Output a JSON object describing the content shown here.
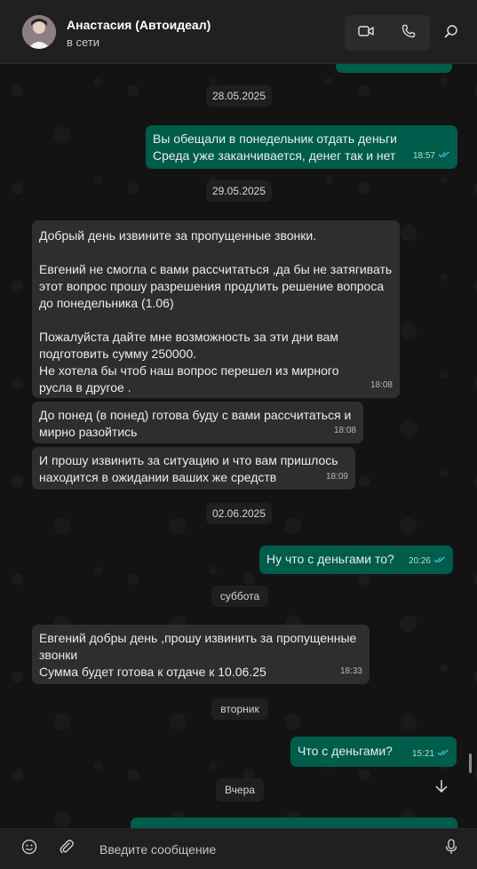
{
  "header": {
    "contact_name": "Анастасия (Автоидеал)",
    "contact_status": "в сети"
  },
  "dates": [
    "28.05.2025",
    "29.05.2025",
    "02.06.2025",
    "суббота",
    "вторник",
    "Вчера"
  ],
  "messages": [
    {
      "dir": "out",
      "text": "Вы обещали в понедельник отдать деньги\nСреда уже заканчивается, денег так и нет",
      "time": "18:57"
    },
    {
      "dir": "in",
      "text": "Добрый день извините за пропущенные звонки.\n\nЕвгений не смогла с вами рассчитаться ,да бы не затягивать\nэтот вопрос прошу разрешения продлить решение вопроса\nдо понедельника (1.06)\n\nПожалуйста дайте мне возможность за эти дни вам\nподготовить сумму 250000.\nНе хотела бы чтоб наш вопрос перешел из мирного\nрусла в другое .",
      "time": "18:08"
    },
    {
      "dir": "in",
      "text": "До понед (в понед) готова буду с вами рассчитаться и\nмирно разойтись",
      "time": "18:08"
    },
    {
      "dir": "in",
      "text": "И прошу извинить за ситуацию и что вам пришлось\nнаходится в ожидании ваших же средств",
      "time": "18:09"
    },
    {
      "dir": "out",
      "text": "Ну что с деньгами то?",
      "time": "20:26"
    },
    {
      "dir": "in",
      "text": "Евгений добры день ,прошу извинить за пропущенные\nзвонки\nСумма будет готова к отдаче к 10.06.25",
      "time": "18:33"
    },
    {
      "dir": "out",
      "text": "Что с деньгами?",
      "time": "15:21"
    }
  ],
  "composer": {
    "placeholder": "Введите сообщение"
  },
  "icons": [
    "video-call-icon",
    "voice-call-icon",
    "search-icon",
    "emoji-icon",
    "attach-icon",
    "microphone-icon",
    "chevron-down-icon",
    "double-check-icon"
  ],
  "colors": {
    "outgoing_bubble": "#005c4b",
    "incoming_bubble": "#2e2e2e",
    "read_check": "#53bdeb"
  }
}
